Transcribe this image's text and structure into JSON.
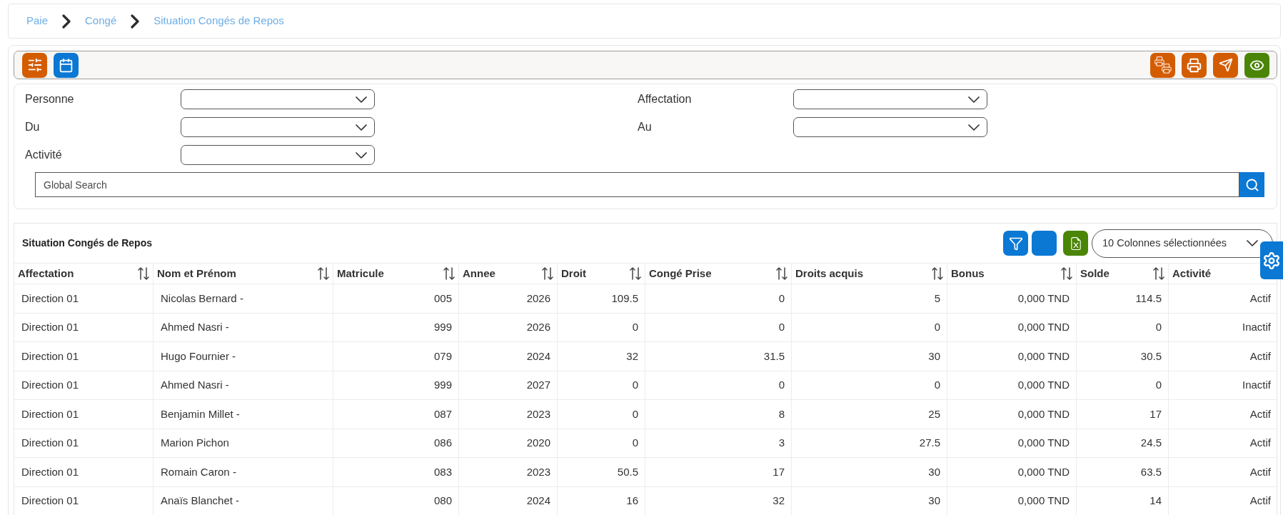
{
  "breadcrumb": [
    {
      "label": "Paie"
    },
    {
      "label": "Congé"
    },
    {
      "label": "Situation Congés de Repos"
    }
  ],
  "filters": [
    {
      "label": "Personne"
    },
    {
      "label": "Affectation"
    },
    {
      "label": "Du"
    },
    {
      "label": "Au"
    },
    {
      "label": "Activité"
    }
  ],
  "search": {
    "placeholder": "Global Search"
  },
  "table": {
    "title": "Situation Congés de Repos",
    "column_selector": "10 Colonnes sélectionnées",
    "columns": [
      "Affectation",
      "Nom et Prénom",
      "Matricule",
      "Annee",
      "Droit",
      "Congé Prise",
      "Droits acquis",
      "Bonus",
      "Solde",
      "Activité"
    ],
    "rows": [
      [
        "Direction 01",
        "Nicolas Bernard -",
        "005",
        "2026",
        "109.5",
        "0",
        "5",
        "0,000 TND",
        "114.5",
        "Actif"
      ],
      [
        "Direction 01",
        "Ahmed Nasri -",
        "999",
        "2026",
        "0",
        "0",
        "0",
        "0,000 TND",
        "0",
        "Inactif"
      ],
      [
        "Direction 01",
        "Hugo Fournier -",
        "079",
        "2024",
        "32",
        "31.5",
        "30",
        "0,000 TND",
        "30.5",
        "Actif"
      ],
      [
        "Direction 01",
        "Ahmed Nasri -",
        "999",
        "2027",
        "0",
        "0",
        "0",
        "0,000 TND",
        "0",
        "Inactif"
      ],
      [
        "Direction 01",
        "Benjamin Millet -",
        "087",
        "2023",
        "0",
        "8",
        "25",
        "0,000 TND",
        "17",
        "Actif"
      ],
      [
        "Direction 01",
        "Marion Pichon",
        "086",
        "2020",
        "0",
        "3",
        "27.5",
        "0,000 TND",
        "24.5",
        "Actif"
      ],
      [
        "Direction 01",
        "Romain Caron -",
        "083",
        "2023",
        "50.5",
        "17",
        "30",
        "0,000 TND",
        "63.5",
        "Actif"
      ],
      [
        "Direction 01",
        "Anaïs Blanchet -",
        "080",
        "2024",
        "16",
        "32",
        "30",
        "0,000 TND",
        "14",
        "Actif"
      ]
    ]
  }
}
